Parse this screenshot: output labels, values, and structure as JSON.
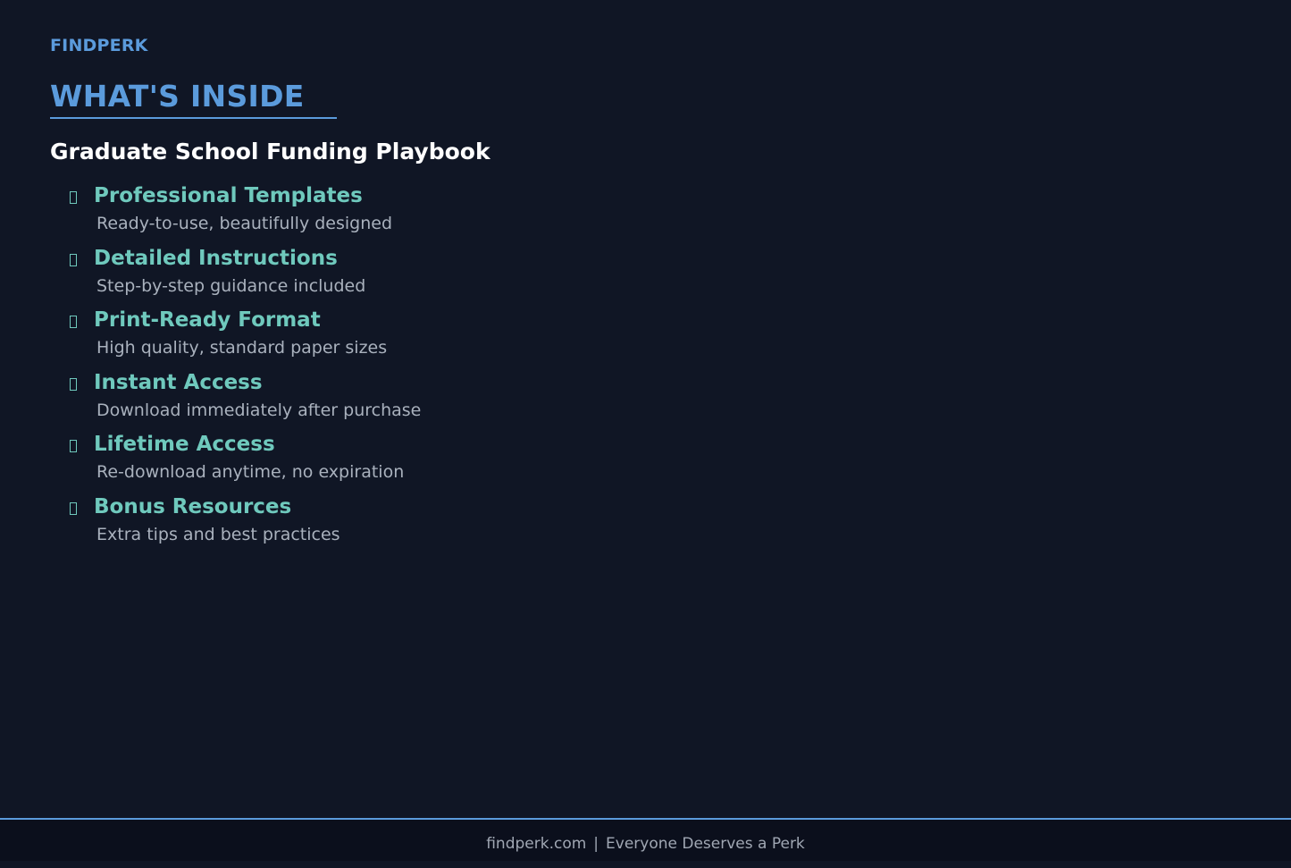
{
  "brand": "FINDPERK",
  "heading": "WHAT'S INSIDE",
  "subtitle": "Graduate School Funding Playbook",
  "features": [
    {
      "title": "Professional Templates",
      "description": "Ready-to-use, beautifully designed",
      "icon": "checkbox-icon"
    },
    {
      "title": "Detailed Instructions",
      "description": "Step-by-step guidance included",
      "icon": "checkbox-icon"
    },
    {
      "title": "Print-Ready Format",
      "description": "High quality, standard paper sizes",
      "icon": "checkbox-icon"
    },
    {
      "title": "Instant Access",
      "description": "Download immediately after purchase",
      "icon": "checkbox-icon"
    },
    {
      "title": "Lifetime Access",
      "description": "Re-download anytime, no expiration",
      "icon": "checkbox-icon"
    },
    {
      "title": "Bonus Resources",
      "description": "Extra tips and best practices",
      "icon": "checkbox-icon"
    }
  ],
  "footer": {
    "site": "findperk.com",
    "separator": "|",
    "tagline": "Everyone Deserves a Perk"
  },
  "colors": {
    "background": "#101625",
    "accent": "#5b9bdc",
    "feature_title": "#6fc9bd",
    "feature_desc": "#a9b1bd",
    "footer_bg": "#0b0f1c"
  }
}
